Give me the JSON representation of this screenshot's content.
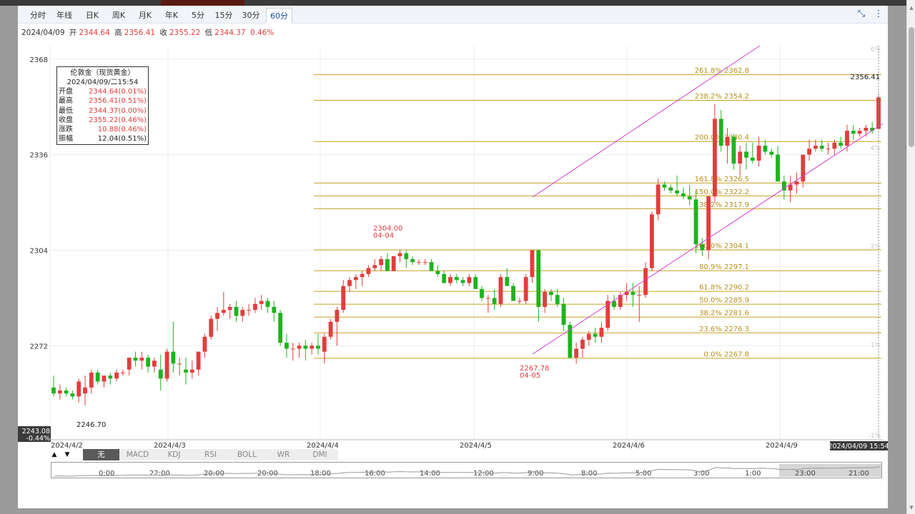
{
  "window": {
    "tabs": [
      "分时",
      "年线",
      "日K",
      "周K",
      "月K",
      "年K",
      "5分",
      "15分",
      "30分",
      "60分"
    ],
    "active_tab": "60分",
    "icons": [
      "fullscreen-exit-icon",
      "more-vertical-icon"
    ]
  },
  "ohlc_bar": {
    "date": "2024/04/09",
    "open_label": "开",
    "open": "2344.64",
    "high_label": "高",
    "high": "2356.41",
    "close_label": "收",
    "close": "2355.22",
    "low_label": "低",
    "low": "2344.37",
    "change": "0.46%"
  },
  "info_box": {
    "title": "伦敦金（现货黄金）",
    "datetime": "2024/04/09/二15:54",
    "rows": [
      {
        "label": "开盘",
        "value": "2344.64(0.01%)"
      },
      {
        "label": "最高",
        "value": "2356.41(0.51%)"
      },
      {
        "label": "最低",
        "value": "2344.37(0.00%)"
      },
      {
        "label": "收盘",
        "value": "2355.22(0.46%)"
      },
      {
        "label": "涨跌",
        "value": "10.88(0.46%)"
      },
      {
        "label": "振幅",
        "value": "12.04(0.51%)"
      }
    ]
  },
  "chart_data": {
    "type": "candlestick",
    "y_ticks": [
      "2368",
      "2336",
      "2304",
      "2272"
    ],
    "ylim": [
      2243.08,
      2368
    ],
    "right_pct_ticks": [
      "6%",
      "4%",
      "2%",
      "1%",
      "-1%"
    ],
    "x_ticks": [
      "2024/4/2",
      "2024/4/3",
      "2024/4/4",
      "2024/4/5",
      "2024/4/6",
      "2024/4/9"
    ],
    "crosshair_price": "2243.08",
    "crosshair_pct": "-0.44%",
    "crosshair_time": "2024/04/09 15:54",
    "last_price": "2356.41",
    "annotations": [
      {
        "text": "2246.70"
      },
      {
        "text": "2304.00",
        "sub": "04-04"
      },
      {
        "text": "2267.78",
        "sub": "04-05"
      }
    ],
    "fib_levels": [
      {
        "label": "261.8% 2362.8",
        "value": 2362.8
      },
      {
        "label": "238.2% 2354.2",
        "value": 2354.2
      },
      {
        "label": "200.0% 2340.4",
        "value": 2340.4
      },
      {
        "label": "161.8% 2326.5",
        "value": 2326.5
      },
      {
        "label": "150.0% 2322.2",
        "value": 2322.2
      },
      {
        "label": "138.2% 2317.9",
        "value": 2317.9
      },
      {
        "label": "100.0% 2304.1",
        "value": 2304.1
      },
      {
        "label": "80.9% 2297.1",
        "value": 2297.1
      },
      {
        "label": "61.8% 2290.2",
        "value": 2290.2
      },
      {
        "label": "50.0% 2285.9",
        "value": 2285.9
      },
      {
        "label": "38.2% 2281.6",
        "value": 2281.6
      },
      {
        "label": "23.6% 2276.3",
        "value": 2276.3
      },
      {
        "label": "0.0% 2267.8",
        "value": 2267.8
      }
    ],
    "candles": [
      [
        2258,
        2262,
        2255,
        2256
      ],
      [
        2256,
        2259,
        2254,
        2257
      ],
      [
        2257,
        2258,
        2255,
        2256
      ],
      [
        2256,
        2257,
        2254,
        2255
      ],
      [
        2255,
        2261,
        2253,
        2260
      ],
      [
        2256,
        2262,
        2252,
        2258
      ],
      [
        2258,
        2264,
        2256,
        2263
      ],
      [
        2263,
        2264,
        2259,
        2260
      ],
      [
        2260,
        2262,
        2258,
        2262
      ],
      [
        2262,
        2263,
        2259,
        2261
      ],
      [
        2261,
        2264,
        2260,
        2263
      ],
      [
        2263,
        2264,
        2262,
        2263
      ],
      [
        2264,
        2268,
        2262,
        2268
      ],
      [
        2268,
        2270,
        2265,
        2267
      ],
      [
        2267,
        2270,
        2264,
        2268
      ],
      [
        2268,
        2269,
        2263,
        2265
      ],
      [
        2265,
        2268,
        2263,
        2267
      ],
      [
        2264,
        2269,
        2257,
        2261
      ],
      [
        2261,
        2271,
        2260,
        2270
      ],
      [
        2270,
        2280,
        2263,
        2266
      ],
      [
        2266,
        2268,
        2262,
        2266
      ],
      [
        2264,
        2268,
        2259,
        2263
      ],
      [
        2263,
        2267,
        2261,
        2264
      ],
      [
        2264,
        2270,
        2262,
        2270
      ],
      [
        2270,
        2276,
        2268,
        2275
      ],
      [
        2275,
        2282,
        2274,
        2281
      ],
      [
        2281,
        2285,
        2277,
        2283
      ],
      [
        2283,
        2290,
        2282,
        2284
      ],
      [
        2284,
        2286,
        2281,
        2285
      ],
      [
        2285,
        2287,
        2280,
        2282
      ],
      [
        2282,
        2285,
        2280,
        2284
      ],
      [
        2284,
        2286,
        2282,
        2284
      ],
      [
        2284,
        2288,
        2283,
        2286
      ],
      [
        2286,
        2289,
        2284,
        2287
      ],
      [
        2287,
        2288,
        2283,
        2285
      ],
      [
        2285,
        2287,
        2280,
        2283
      ],
      [
        2283,
        2284,
        2272,
        2273
      ],
      [
        2273,
        2276,
        2268,
        2271
      ],
      [
        2271,
        2273,
        2267,
        2271
      ],
      [
        2271,
        2273,
        2268,
        2272
      ],
      [
        2272,
        2274,
        2267,
        2271
      ],
      [
        2271,
        2273,
        2269,
        2272
      ],
      [
        2272,
        2276,
        2269,
        2271
      ],
      [
        2270,
        2276,
        2266,
        2275
      ],
      [
        2275,
        2281,
        2274,
        2280
      ],
      [
        2280,
        2285,
        2272,
        2284
      ],
      [
        2284,
        2294,
        2283,
        2292
      ],
      [
        2292,
        2295,
        2290,
        2294
      ],
      [
        2294,
        2296,
        2291,
        2295
      ],
      [
        2295,
        2297,
        2292,
        2296
      ],
      [
        2296,
        2299,
        2295,
        2298
      ],
      [
        2298,
        2301,
        2297,
        2299
      ],
      [
        2299,
        2302,
        2297,
        2301
      ],
      [
        2301,
        2303,
        2297,
        2297
      ],
      [
        2297,
        2301,
        2297,
        2302
      ],
      [
        2302,
        2304,
        2300,
        2303
      ],
      [
        2303,
        2304,
        2298,
        2301
      ],
      [
        2301,
        2302,
        2299,
        2300
      ],
      [
        2300,
        2301,
        2299,
        2300
      ],
      [
        2300,
        2301,
        2299,
        2300
      ],
      [
        2300,
        2301,
        2298,
        2297
      ],
      [
        2297,
        2299,
        2295,
        2296
      ],
      [
        2296,
        2297,
        2293,
        2293
      ],
      [
        2293,
        2296,
        2292,
        2295
      ],
      [
        2295,
        2296,
        2293,
        2294
      ],
      [
        2294,
        2295,
        2292,
        2293
      ],
      [
        2293,
        2296,
        2292,
        2295
      ],
      [
        2295,
        2296,
        2292,
        2291
      ],
      [
        2291,
        2292,
        2287,
        2288
      ],
      [
        2288,
        2289,
        2283,
        2288
      ],
      [
        2288,
        2291,
        2284,
        2286
      ],
      [
        2286,
        2296,
        2285,
        2295
      ],
      [
        2295,
        2298,
        2292,
        2292
      ],
      [
        2292,
        2293,
        2287,
        2287
      ],
      [
        2287,
        2288,
        2286,
        2287
      ],
      [
        2287,
        2296,
        2286,
        2295
      ],
      [
        2295,
        2304,
        2293,
        2304
      ],
      [
        2304,
        2304,
        2280,
        2285
      ],
      [
        2285,
        2291,
        2283,
        2290
      ],
      [
        2290,
        2291,
        2287,
        2289
      ],
      [
        2289,
        2291,
        2285,
        2286
      ],
      [
        2286,
        2288,
        2277,
        2279
      ],
      [
        2279,
        2280,
        2267.78,
        2268
      ],
      [
        2268,
        2273,
        2266,
        2271
      ],
      [
        2271,
        2275,
        2268,
        2274
      ],
      [
        2274,
        2277,
        2272,
        2276
      ],
      [
        2276,
        2278,
        2273,
        2275
      ],
      [
        2275,
        2280,
        2273,
        2278
      ],
      [
        2278,
        2289,
        2277,
        2287
      ],
      [
        2287,
        2289,
        2284,
        2285
      ],
      [
        2285,
        2290,
        2284,
        2289
      ],
      [
        2289,
        2293,
        2287,
        2290
      ],
      [
        2290,
        2293,
        2285,
        2289
      ],
      [
        2289,
        2292,
        2280,
        2289
      ],
      [
        2289,
        2300,
        2288,
        2298
      ],
      [
        2298,
        2317,
        2297,
        2316
      ],
      [
        2316,
        2328,
        2314,
        2326
      ],
      [
        2326,
        2327,
        2324,
        2325
      ],
      [
        2325,
        2326,
        2323,
        2324
      ],
      [
        2324,
        2329,
        2322,
        2323
      ],
      [
        2323,
        2325,
        2321,
        2322
      ],
      [
        2322,
        2326,
        2319,
        2321
      ],
      [
        2321,
        2324,
        2303,
        2306
      ],
      [
        2306,
        2308,
        2302,
        2304
      ],
      [
        2304,
        2322,
        2301,
        2322
      ],
      [
        2322,
        2353,
        2320,
        2348
      ],
      [
        2348,
        2351,
        2337,
        2339
      ],
      [
        2339,
        2345,
        2333,
        2342
      ],
      [
        2342,
        2343,
        2331,
        2333
      ],
      [
        2333,
        2339,
        2329,
        2337
      ],
      [
        2337,
        2340,
        2331,
        2335
      ],
      [
        2335,
        2340,
        2333,
        2334
      ],
      [
        2334,
        2342,
        2332,
        2339
      ],
      [
        2339,
        2341,
        2336,
        2337
      ],
      [
        2337,
        2338,
        2335,
        2336
      ],
      [
        2336,
        2339,
        2331,
        2327
      ],
      [
        2327,
        2329,
        2321,
        2324
      ],
      [
        2324,
        2329,
        2320,
        2326
      ],
      [
        2326,
        2330,
        2323,
        2327
      ],
      [
        2327,
        2335,
        2325,
        2336
      ],
      [
        2336,
        2341,
        2334,
        2338
      ],
      [
        2338,
        2341,
        2337,
        2339
      ],
      [
        2339,
        2341,
        2337,
        2338
      ],
      [
        2338,
        2340,
        2336,
        2338
      ],
      [
        2338,
        2341,
        2336,
        2340
      ],
      [
        2340,
        2342,
        2338,
        2339
      ],
      [
        2339,
        2346,
        2337,
        2344
      ],
      [
        2344,
        2346,
        2341,
        2343
      ],
      [
        2343,
        2345,
        2342,
        2344
      ],
      [
        2344,
        2346,
        2342,
        2345
      ],
      [
        2345,
        2347,
        2343,
        2344
      ],
      [
        2344.64,
        2356.41,
        2344.37,
        2355.22
      ]
    ],
    "nav_labels": [
      "0:00",
      "22:00",
      "20:00",
      "20:00",
      "18:00",
      "16:00",
      "14:00",
      "12:00",
      "9:00",
      "8:00",
      "5:00",
      "3:00",
      "1:00",
      "23:00",
      "21:00"
    ]
  },
  "indicators": {
    "items": [
      "无",
      "MACD",
      "KDJ",
      "RSI",
      "BOLL",
      "WR",
      "DMI"
    ],
    "active": "无",
    "arrows": [
      "▲",
      "▼"
    ]
  },
  "colors": {
    "up": "#e23d3d",
    "down": "#1fb31f",
    "fib": "#c8a020",
    "channel": "#d43cd4",
    "accent": "#1a4fa0"
  }
}
